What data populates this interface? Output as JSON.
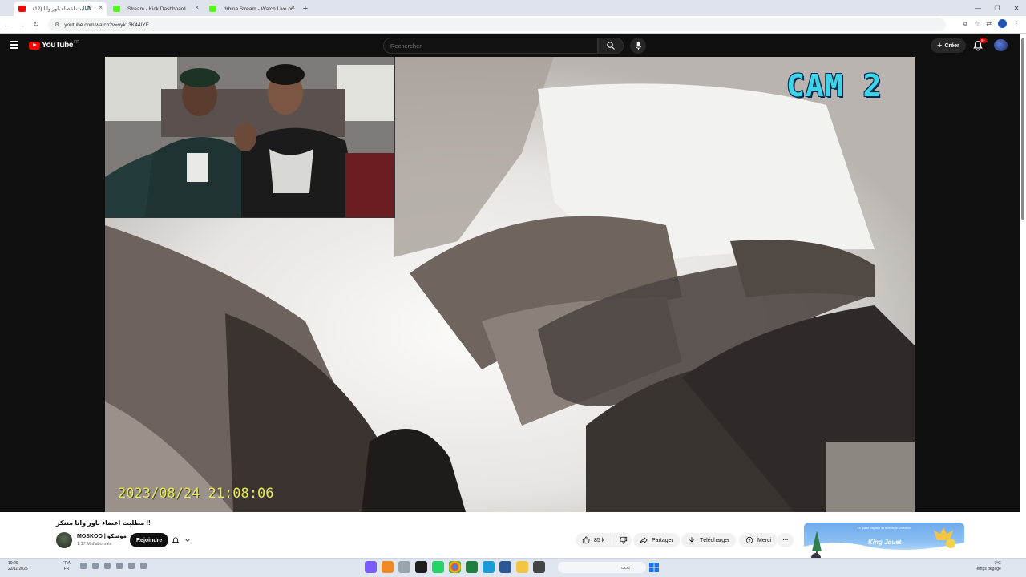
{
  "browser": {
    "tabs": [
      {
        "title": "مطلبت اعضاء باور وانا (12)",
        "icon": "youtube-icon",
        "color": "#ff0000"
      },
      {
        "title": "Stream · Kick Dashboard",
        "icon": "kick-icon",
        "color": "#53fc18"
      },
      {
        "title": "drbina Stream - Watch Live on",
        "icon": "kick-icon",
        "color": "#53fc18"
      }
    ],
    "url": "youtube.com/watch?v=vyk13K44IYE"
  },
  "youtube": {
    "logo_text": "YouTube",
    "country": "FR",
    "search_placeholder": "Rechercher",
    "create_label": "Créer",
    "notification_badge": "9+"
  },
  "video": {
    "cam_label": "CAM 2",
    "timestamp": "2023/08/24  21:08:06",
    "title": "!! مطلبت اعضاء باور وانا متنكر",
    "channel_name": "MOSKOO | موسكو",
    "subscribers": "1,17 M d'abonnés",
    "join_label": "Rejoindre",
    "likes": "85 k",
    "share_label": "Partager",
    "download_label": "Télécharger",
    "thanks_label": "Merci",
    "ad_brand": "King Jouet",
    "ad_tagline": "Le grand magasin du Noël de la Collection"
  },
  "taskbar": {
    "time": "10:20",
    "date": "22/11/2025",
    "lang_top": "FRA",
    "lang_bottom": "FR",
    "search_text": "بحث",
    "weather_temp": "7°C",
    "weather_desc": "Temps dégagé"
  },
  "colors": {
    "accent": "#ff0000",
    "cam_label": "#3ad6e8",
    "timestamp": "#e8e84a"
  }
}
